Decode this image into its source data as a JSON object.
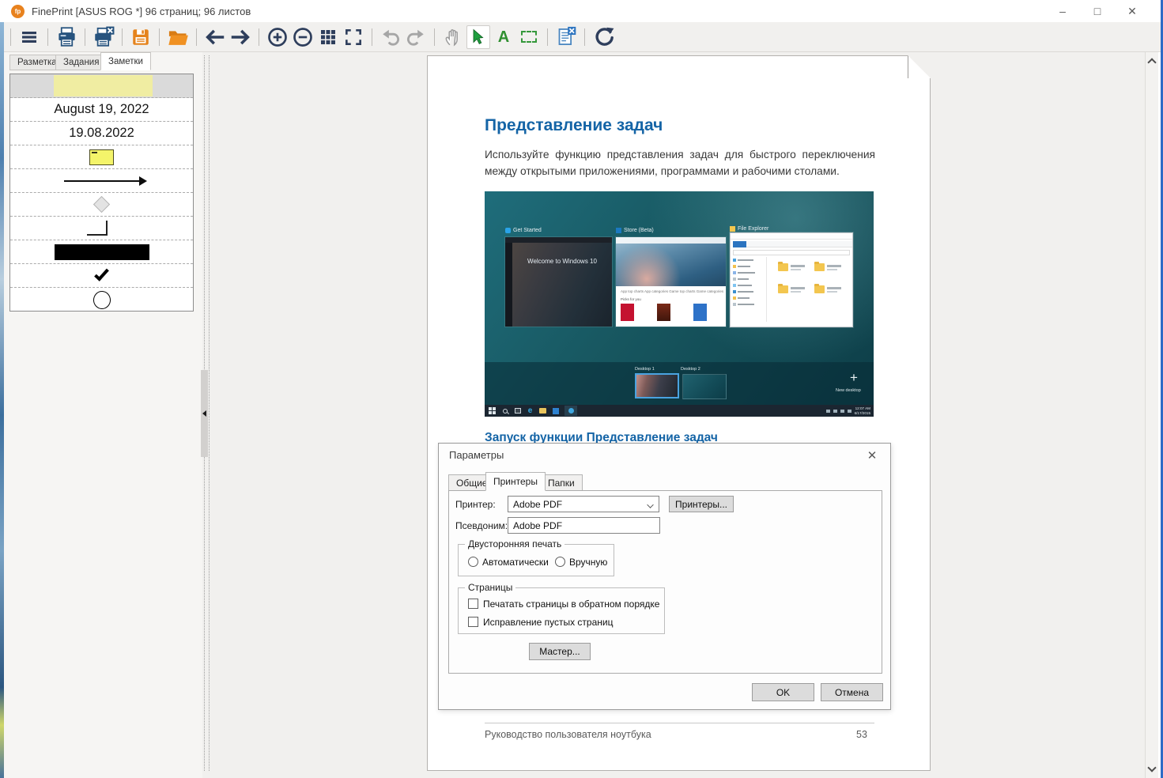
{
  "window": {
    "title": "FinePrint [ASUS ROG *] 96 страниц; 96 листов",
    "logo_text": "fp",
    "controls": {
      "minimize": "–",
      "maximize": "□",
      "close": "✕"
    }
  },
  "toolbar": {
    "text_tool_glyph": "A",
    "icons": [
      "menu",
      "print",
      "print-delete",
      "save",
      "open-folder",
      "back-arrow",
      "forward-arrow",
      "zoom-in",
      "zoom-out",
      "thumbnail-grid",
      "fit-page",
      "undo",
      "redo",
      "hand-tool",
      "select-cursor",
      "text-note-tool",
      "marquee-select",
      "note-delete",
      "refresh"
    ],
    "colors": {
      "navy": "#2e3e5c",
      "orange": "#e5831c",
      "green": "#1f9e3e",
      "disabled_gray": "#a6a6a6",
      "doc_blue": "#4a86c0"
    }
  },
  "sidebar": {
    "tabs": [
      {
        "label": "Разметка",
        "active": false
      },
      {
        "label": "Задания",
        "active": false
      },
      {
        "label": "Заметки",
        "active": true
      }
    ],
    "notes": {
      "date_long": "August 19, 2022",
      "date_short": "19.08.2022",
      "items": [
        "highlight",
        "date-long",
        "date-short",
        "sticky-note",
        "arrow",
        "diamond",
        "corner-lines",
        "filled-rectangle",
        "checkmark",
        "circle"
      ]
    }
  },
  "document": {
    "heading": "Представление задач",
    "paragraph": "Используйте функцию представления задач для быстрого переключения между открытыми приложениями, программами и рабочими столами.",
    "heading2": "Запуск функции Представление задач",
    "footer_text": "Руководство пользователя ноутбука",
    "page_number": "53",
    "accent_color": "#1464a6"
  },
  "screenshot": {
    "window1_title": "Get Started",
    "window1_caption": "Welcome to Windows 10",
    "window2_title": "Store (Beta)",
    "window2_links": "App top charts   App categories   Game top charts   Game categories",
    "window2_picks": "Picks for you",
    "window3_title": "File Explorer",
    "desktop1": "Desktop 1",
    "desktop2": "Desktop 2",
    "new_desktop_plus": "+",
    "new_desktop": "New desktop",
    "clock_time": "12:07 AM",
    "clock_date": "6/17/2015",
    "edge_glyph": "e"
  },
  "dialog": {
    "title": "Параметры",
    "close_glyph": "✕",
    "tabs": [
      {
        "label": "Общие",
        "active": false
      },
      {
        "label": "Принтеры",
        "active": true
      },
      {
        "label": "Папки",
        "active": false
      }
    ],
    "printer_label": "Принтер:",
    "printer_value": "Adobe PDF",
    "printers_button": "Принтеры...",
    "alias_label": "Псевдоним:",
    "alias_value": "Adobe PDF",
    "duplex": {
      "title": "Двусторонняя печать",
      "options": [
        {
          "label": "Автоматически",
          "selected": false
        },
        {
          "label": "Вручную",
          "selected": false
        }
      ]
    },
    "pages": {
      "title": "Страницы",
      "options": [
        {
          "label": "Печатать страницы в обратном порядке",
          "checked": false
        },
        {
          "label": "Исправление пустых страниц",
          "checked": false
        }
      ]
    },
    "master_button": "Мастер...",
    "ok_button": "OK",
    "cancel_button": "Отмена"
  }
}
